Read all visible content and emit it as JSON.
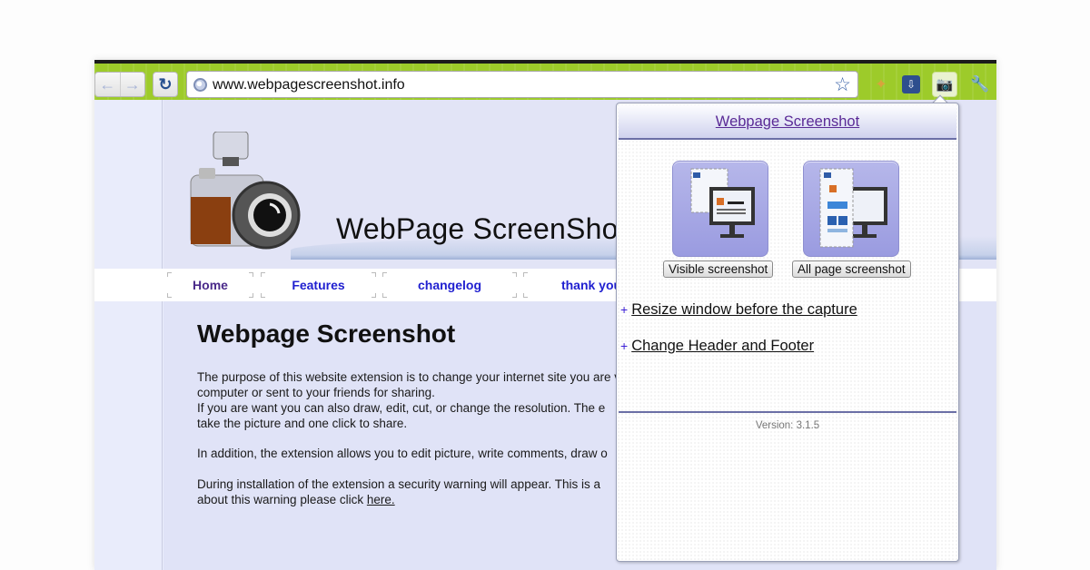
{
  "browser": {
    "back_icon": "arrow-left-icon",
    "forward_icon": "arrow-right-icon",
    "reload_icon": "reload-icon",
    "url": "www.webpagescreenshot.info",
    "bookmark_icon": "star-icon",
    "extensions": [
      "feather-icon",
      "download-extension-icon",
      "camera-extension-icon",
      "wrench-icon"
    ],
    "theme_color": "#9dcb2a"
  },
  "site": {
    "title": "WebPage ScreenShot",
    "menu": [
      {
        "label": "Home"
      },
      {
        "label": "Features"
      },
      {
        "label": "changelog"
      },
      {
        "label": "thank you"
      }
    ],
    "heading": "Webpage Screenshot",
    "paragraphs": {
      "p1_line1": "The purpose of this website extension is to change your internet site you are view",
      "p1_line2": "computer or sent to your friends for sharing.",
      "p1_line3": "If you are want you can also draw, edit, cut, or change the resolution. The e",
      "p1_line4": "take the picture and one click to share.",
      "p2": "In addition, the extension allows you to edit picture, write comments, draw o",
      "p3_line1": "During installation of the extension a security warning will appear. This is a",
      "p3_line2": "about this warning please click ",
      "p3_link": "here."
    }
  },
  "popup": {
    "title": "Webpage Screenshot",
    "visible_button": "Visible screenshot",
    "all_page_button": "All page screenshot",
    "options": [
      {
        "plus": "+",
        "label": "Resize window before the capture"
      },
      {
        "plus": "+",
        "label": "Change Header and Footer"
      }
    ],
    "version": "Version: 3.1.5",
    "accent_color": "#6b6fa6"
  }
}
